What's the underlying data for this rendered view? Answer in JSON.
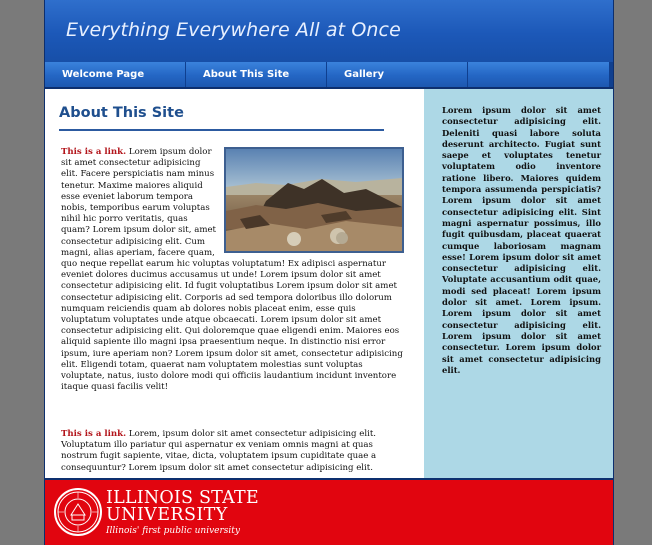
{
  "site": {
    "title": "Everything Everywhere All at Once"
  },
  "nav": {
    "items": [
      {
        "label": "Welcome Page"
      },
      {
        "label": "About This Site"
      },
      {
        "label": "Gallery"
      },
      {
        "label": ""
      }
    ]
  },
  "main": {
    "heading": "About This Site",
    "paragraphs": [
      {
        "link": "This is a link.",
        "text": " Lorem ipsum dolor sit amet consectetur adipisicing elit. Facere perspiciatis nam minus tenetur. Maxime maiores aliquid esse eveniet laborum tempora nobis, temporibus earum voluptas nihil hic porro veritatis, quas quam? Lorem ipsum dolor sit, amet consectetur adipisicing elit. Cum magni, alias aperiam, facere quam, quo neque repellat earum hic voluptas voluptatum! Ex adipisci aspernatur eveniet dolores ducimus accusamus ut unde! Lorem ipsum dolor sit amet consectetur adipisicing elit. Id fugit voluptatibus Lorem ipsum dolor sit amet consectetur adipisicing elit. Corporis ad sed tempora doloribus illo dolorum numquam reiciendis quam ab dolores nobis placeat enim, esse quis voluptatum voluptates unde atque obcaecati. Lorem ipsum dolor sit amet consectetur adipisicing elit. Qui doloremque quae eligendi enim. Maiores eos aliquid sapiente illo magni ipsa praesentium neque. In distinctio nisi error ipsum, iure aperiam non? Lorem ipsum dolor sit amet, consectetur adipisicing elit. Eligendi totam, quaerat nam voluptatem molestias sunt voluptas voluptate, natus, iusto dolore modi qui officiis laudantium incidunt inventore itaque quasi facilis velit!"
      },
      {
        "link": "This is a link.",
        "text": " Lorem, ipsum dolor sit amet consectetur adipisicing elit. Voluptatum illo pariatur qui aspernatur ex veniam omnis magni at quas nostrum fugit sapiente, vitae, dicta, voluptatem ipsum cupiditate quae a consequuntur? Lorem ipsum dolor sit amet consectetur adipisicing elit."
      }
    ]
  },
  "sidebar": {
    "text": "Lorem ipsum dolor sit amet consectetur adipisicing elit. Deleniti quasi labore soluta deserunt architecto. Fugiat sunt saepe et voluptates tenetur voluptatem odio inventore ratione libero. Maiores quidem tempora assumenda perspiciatis? Lorem ipsum dolor sit amet consectetur adipisicing elit. Sint magni aspernatur possimus, illo fugit quibusdam, placeat quaerat cumque laboriosam magnam esse! Lorem ipsum dolor sit amet consectetur adipisicing elit. Voluptate accusantium odit quae, modi sed placeat! Lorem ipsum dolor sit amet. Lorem ipsum. Lorem ipsum dolor sit amet consectetur adipisicing elit. Lorem ipsum dolor sit amet consectetur. Lorem ipsum dolor sit amet consectetur adipisicing elit."
  },
  "footer": {
    "university_line1": "ILLINOIS STATE",
    "university_line2": "UNIVERSITY",
    "tagline": "Illinois' first public university"
  },
  "colors": {
    "banner_blue": "#1c58b8",
    "nav_blue": "#2466c4",
    "heading_blue": "#1f4f8e",
    "link_red": "#b3151b",
    "sidebar_bg": "#add8e6",
    "footer_red": "#e1050f",
    "outer_gray": "#7a7a7a"
  },
  "icons": {
    "footer_seal": "university-seal-icon",
    "photo": "desert-mountain-landscape"
  }
}
